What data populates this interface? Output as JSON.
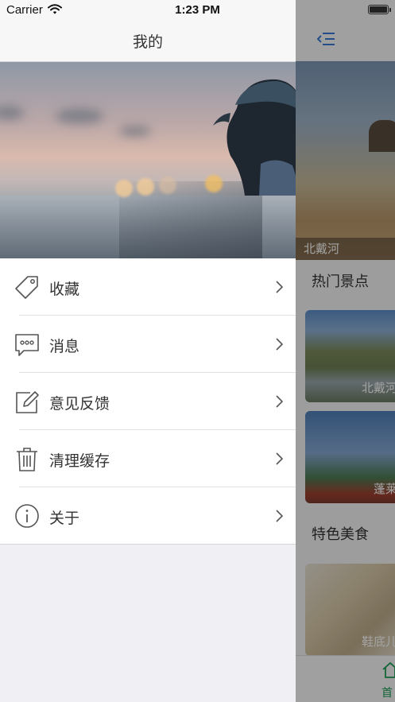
{
  "status_bar": {
    "carrier": "Carrier",
    "time": "1:23 PM"
  },
  "drawer": {
    "title": "我的",
    "menu": [
      {
        "label": "收藏",
        "icon": "tag-icon"
      },
      {
        "label": "消息",
        "icon": "message-icon"
      },
      {
        "label": "意见反馈",
        "icon": "edit-icon"
      },
      {
        "label": "清理缓存",
        "icon": "trash-icon"
      },
      {
        "label": "关于",
        "icon": "info-icon"
      }
    ]
  },
  "background_page": {
    "banner_label": "北戴河",
    "sections": {
      "hot_spots": "热门景点",
      "food": "特色美食"
    },
    "cards": [
      "北戴河",
      "蓬莱",
      "鞋底儿"
    ],
    "tab": "首"
  },
  "colors": {
    "accent": "#1f9f57",
    "menu_icon": "#3a7bd5"
  }
}
